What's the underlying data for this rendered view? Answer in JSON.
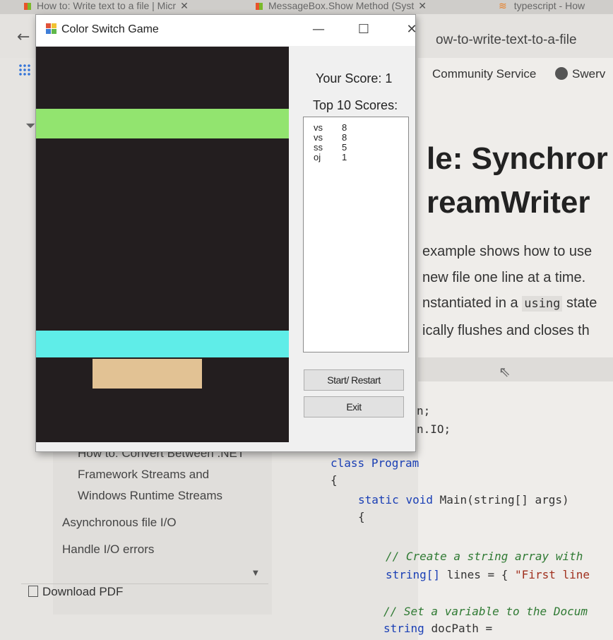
{
  "browser": {
    "tabs": [
      {
        "label": "How to: Write text to a file | Micr",
        "close": "✕"
      },
      {
        "label": "MessageBox.Show Method (Syst",
        "close": "✕"
      },
      {
        "label": "typescript - How"
      }
    ],
    "url_fragment": "ow-to-write-text-to-a-file",
    "nav_links": [
      "Community Service",
      "Swerv"
    ],
    "heading_line1": "le: Synchror",
    "heading_line2": "reamWriter",
    "paragraph": {
      "line1": "example shows how to use",
      "line2": "new file one line at a time.",
      "line3_a": "nstantiated in a",
      "line3_code": "using",
      "line3_b": "state",
      "line4": "ically flushes and closes th"
    },
    "code_lines": {
      "l1": "n;",
      "l2": "n.IO;",
      "class_kw": "class",
      "class_name": "Program",
      "brace1": "{",
      "static_kw": "static",
      "void_kw": "void",
      "main_sig": "Main(string[] args)",
      "brace2": "{",
      "comment1": "// Create a string array with",
      "string_kw": "string[]",
      "lines_decl": "lines = {",
      "lines_str": "\"First line",
      "comment2": "// Set a variable to the Docum",
      "string_kw2": "string",
      "docpath": "docPath ="
    },
    "toc": [
      "How to: Convert Between .NET",
      "Framework Streams and",
      "Windows Runtime Streams",
      "Asynchronous file I/O",
      "Handle I/O errors"
    ],
    "download_pdf": "Download PDF"
  },
  "game_window": {
    "title": "Color Switch Game",
    "controls": {
      "minimize": "—",
      "maximize": "☐",
      "close": "✕"
    },
    "score_label": "Your Score: 1",
    "top_label": "Top 10 Scores:",
    "top_scores": [
      {
        "name": "vs",
        "score": "8"
      },
      {
        "name": "vs",
        "score": "8"
      },
      {
        "name": "ss",
        "score": "5"
      },
      {
        "name": "oj",
        "score": "1"
      }
    ],
    "start_button": "Start/ Restart",
    "exit_button": "Exit",
    "colors": {
      "background": "#231e1f",
      "green_bar": "#92e46f",
      "cyan_bar": "#5fede8",
      "player": "#e2c294"
    }
  }
}
